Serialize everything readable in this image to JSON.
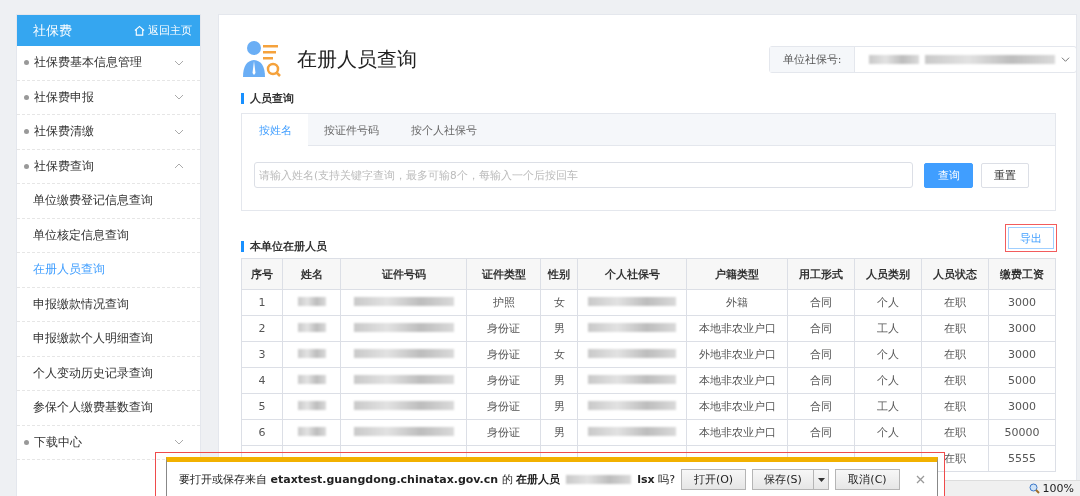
{
  "sidebar": {
    "title": "社保费",
    "home_link": "返回主页",
    "items": [
      {
        "kind": "group",
        "label": "社保费基本信息管理",
        "expanded": false,
        "selected": false
      },
      {
        "kind": "group",
        "label": "社保费申报",
        "expanded": false,
        "selected": false
      },
      {
        "kind": "group",
        "label": "社保费清缴",
        "expanded": false,
        "selected": false
      },
      {
        "kind": "group",
        "label": "社保费查询",
        "expanded": true,
        "selected": false
      },
      {
        "kind": "sub",
        "label": "单位缴费登记信息查询",
        "selected": false
      },
      {
        "kind": "sub",
        "label": "单位核定信息查询",
        "selected": false
      },
      {
        "kind": "sub",
        "label": "在册人员查询",
        "selected": true
      },
      {
        "kind": "sub",
        "label": "申报缴款情况查询",
        "selected": false
      },
      {
        "kind": "sub",
        "label": "申报缴款个人明细查询",
        "selected": false
      },
      {
        "kind": "sub",
        "label": "个人变动历史记录查询",
        "selected": false
      },
      {
        "kind": "sub",
        "label": "参保个人缴费基数查询",
        "selected": false
      },
      {
        "kind": "group",
        "label": "下载中心",
        "expanded": false,
        "selected": false
      }
    ]
  },
  "page": {
    "title": "在册人员查询",
    "unit_select_label": "单位社保号:"
  },
  "query": {
    "heading": "人员查询",
    "tabs": [
      {
        "label": "按姓名",
        "selected": true
      },
      {
        "label": "按证件号码",
        "selected": false
      },
      {
        "label": "按个人社保号",
        "selected": false
      }
    ],
    "placeholder": "请输入姓名(支持关键字查询，最多可输8个，每输入一个后按回车",
    "buttons": [
      {
        "kind": "primary",
        "label": "查询"
      },
      {
        "kind": "default",
        "label": "重置"
      }
    ]
  },
  "list": {
    "heading": "本单位在册人员",
    "export_button": "导出",
    "columns": [
      {
        "label": "序号",
        "kind": "text"
      },
      {
        "label": "姓名",
        "kind": "redacted"
      },
      {
        "label": "证件号码",
        "kind": "redacted"
      },
      {
        "label": "证件类型",
        "kind": "text"
      },
      {
        "label": "性别",
        "kind": "text"
      },
      {
        "label": "个人社保号",
        "kind": "redacted"
      },
      {
        "label": "户籍类型",
        "kind": "text"
      },
      {
        "label": "用工形式",
        "kind": "text"
      },
      {
        "label": "人员类别",
        "kind": "text"
      },
      {
        "label": "人员状态",
        "kind": "text"
      },
      {
        "label": "缴费工资",
        "kind": "text"
      }
    ],
    "rows": [
      [
        "1",
        "",
        "",
        "护照",
        "女",
        "",
        "外籍",
        "合同",
        "个人",
        "在职",
        "3000"
      ],
      [
        "2",
        "",
        "",
        "身份证",
        "男",
        "",
        "本地非农业户口",
        "合同",
        "工人",
        "在职",
        "3000"
      ],
      [
        "3",
        "",
        "",
        "身份证",
        "女",
        "",
        "外地非农业户口",
        "合同",
        "个人",
        "在职",
        "3000"
      ],
      [
        "4",
        "",
        "",
        "身份证",
        "男",
        "",
        "本地非农业户口",
        "合同",
        "个人",
        "在职",
        "5000"
      ],
      [
        "5",
        "",
        "",
        "身份证",
        "男",
        "",
        "本地非农业户口",
        "合同",
        "工人",
        "在职",
        "3000"
      ],
      [
        "6",
        "",
        "",
        "身份证",
        "男",
        "",
        "本地非农业户口",
        "合同",
        "个人",
        "在职",
        "50000"
      ],
      [
        "",
        "",
        "",
        "",
        "",
        "",
        "",
        "",
        "",
        "在职",
        "5555"
      ]
    ]
  },
  "download_bar": {
    "text": "要打开或保存来自 **etaxtest.guangdong.chinatax.gov.cn** 的 **在册人员**",
    "text_end": "**lsx** 吗?",
    "buttons": [
      {
        "kind": "plain",
        "label": "打开(O)"
      },
      {
        "kind": "split",
        "label": "保存(S)"
      },
      {
        "kind": "plain",
        "label": "取消(C)"
      }
    ]
  },
  "zoom": "100%"
}
